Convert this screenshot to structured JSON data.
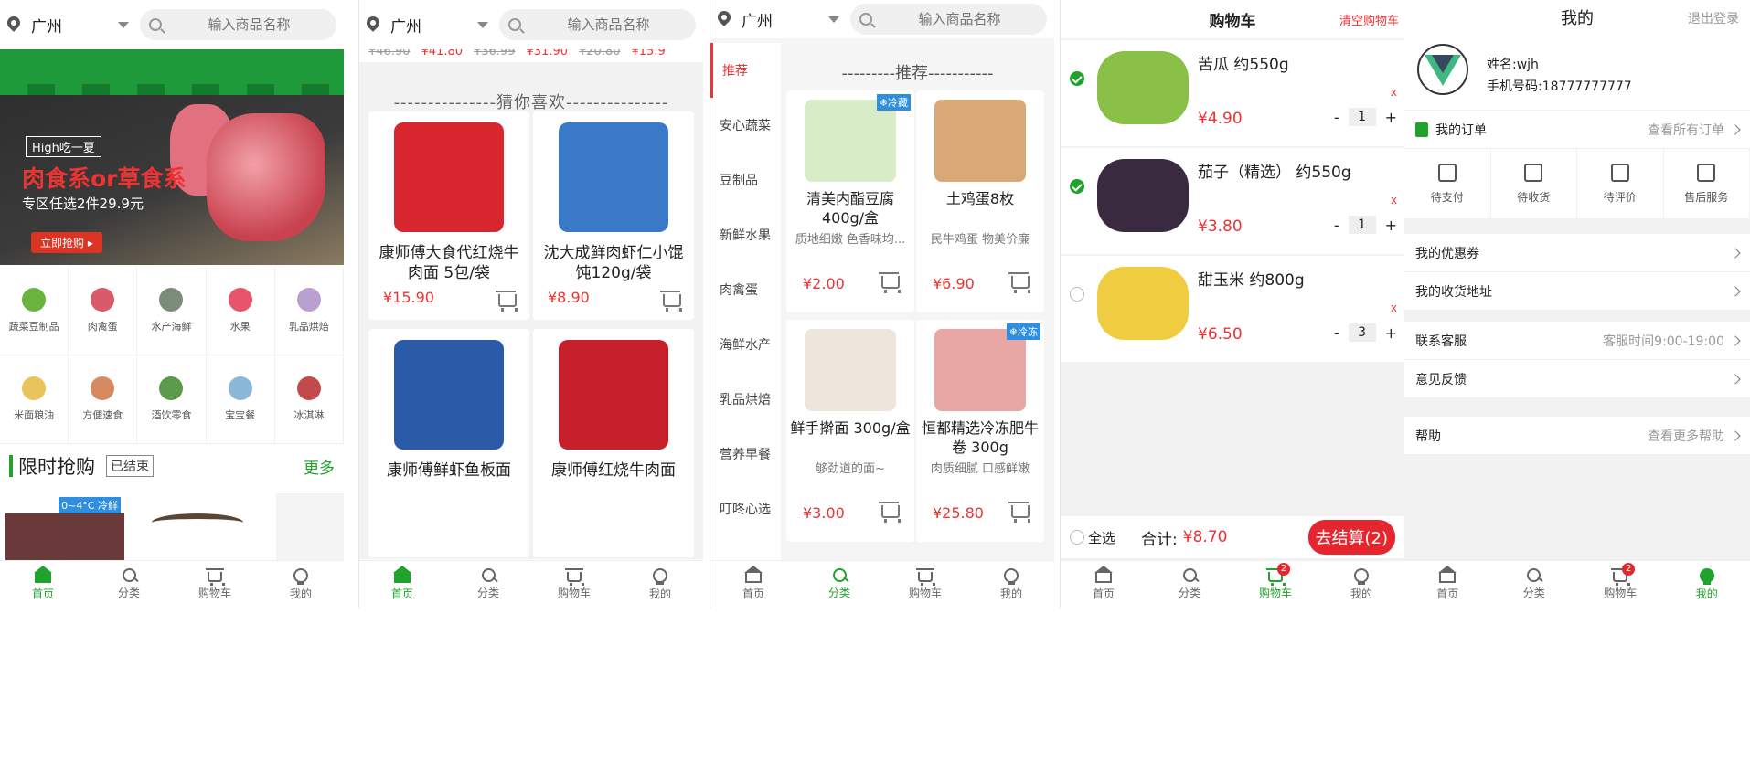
{
  "header": {
    "city": "广州",
    "search_placeholder": "输入商品名称"
  },
  "tabbar": {
    "home": "首页",
    "category": "分类",
    "cart": "购物车",
    "mine": "我的",
    "cart_badge": "2"
  },
  "home": {
    "banner": {
      "t1": "High吃一夏",
      "t2": "肉食系or草食系",
      "t3": "专区任选2件29.9元",
      "t4": "立即抢购 ▸"
    },
    "categories": [
      "蔬菜豆制品",
      "肉禽蛋",
      "水产海鲜",
      "水果",
      "乳品烘焙",
      "米面粮油",
      "方便速食",
      "酒饮零食",
      "宝宝餐",
      "冰淇淋"
    ],
    "category_colors": [
      "#6bb33f",
      "#d95a6a",
      "#7a8d7a",
      "#e8546c",
      "#b8a0d0",
      "#e8c45a",
      "#d68a60",
      "#5a9a4a",
      "#8ab8d8",
      "#c24a4a"
    ],
    "flash": {
      "title": "限时抢购",
      "status": "已结束",
      "more": "更多",
      "tag": "0~4°C 冷鲜"
    }
  },
  "guess": {
    "strip": [
      {
        "old": "¥46.90",
        "price": "¥41.80"
      },
      {
        "old": "¥36.99",
        "price": "¥31.90"
      },
      {
        "old": "¥20.80",
        "price": "¥15.9"
      }
    ],
    "title": "---------------猜你喜欢---------------",
    "items": [
      {
        "name": "康师傅大食代红烧牛肉面 5包/袋",
        "price": "¥15.90",
        "color": "#d8262e"
      },
      {
        "name": "沈大成鲜肉虾仁小馄饨120g/袋",
        "price": "¥8.90",
        "color": "#3a78c8"
      },
      {
        "name": "康师傅鲜虾鱼板面",
        "price": "",
        "color": "#2a5aa8"
      },
      {
        "name": "康师傅红烧牛肉面",
        "price": "",
        "color": "#c8202a"
      }
    ]
  },
  "category_page": {
    "sidebar": [
      "推荐",
      "安心蔬菜",
      "豆制品",
      "新鲜水果",
      "肉禽蛋",
      "海鲜水产",
      "乳品烘焙",
      "营养早餐",
      "叮咚心选"
    ],
    "title": "---------推荐-----------",
    "products": [
      {
        "name": "清美内酯豆腐400g/盒",
        "sub": "质地细嫩 色香味均...",
        "price": "¥2.00",
        "tag": "❄冷藏",
        "color": "#d8ecc8"
      },
      {
        "name": "土鸡蛋8枚",
        "sub": "民牛鸡蛋 物美价廉",
        "price": "¥6.90",
        "tag": "",
        "color": "#d8a877"
      },
      {
        "name": "鲜手擀面 300g/盒",
        "sub": "够劲道的面~",
        "price": "¥3.00",
        "tag": "",
        "color": "#eee6dc"
      },
      {
        "name": "恒都精选冷冻肥牛卷 300g",
        "sub": "肉质细腻 口感鲜嫩",
        "price": "¥25.80",
        "tag": "❄冷冻",
        "color": "#e8a6a4"
      }
    ]
  },
  "cart": {
    "title": "购物车",
    "clear": "清空购物车",
    "items": [
      {
        "name": "苦瓜 约550g",
        "price": "¥4.90",
        "qty": "1",
        "checked": true,
        "color": "#8ac048"
      },
      {
        "name": "茄子（精选） 约550g",
        "price": "¥3.80",
        "qty": "1",
        "checked": true,
        "color": "#3a2a40"
      },
      {
        "name": "甜玉米 约800g",
        "price": "¥6.50",
        "qty": "3",
        "checked": false,
        "color": "#f0cc40"
      }
    ],
    "remove": "x",
    "minus": "-",
    "plus": "+",
    "select_all": "全选",
    "total_label": "合计:",
    "total": "¥8.70",
    "checkout": "去结算(2)"
  },
  "mine": {
    "title": "我的",
    "logout": "退出登录",
    "name": "姓名:wjh",
    "phone": "手机号码:18777777777",
    "orders_label": "我的订单",
    "orders_all": "查看所有订单",
    "order_states": [
      "待支付",
      "待收货",
      "待评价",
      "售后服务"
    ],
    "coupons": "我的优惠券",
    "address": "我的收货地址",
    "service": "联系客服",
    "service_time": "客服时间9:00-19:00",
    "feedback": "意见反馈",
    "help": "帮助",
    "help_more": "查看更多帮助"
  }
}
